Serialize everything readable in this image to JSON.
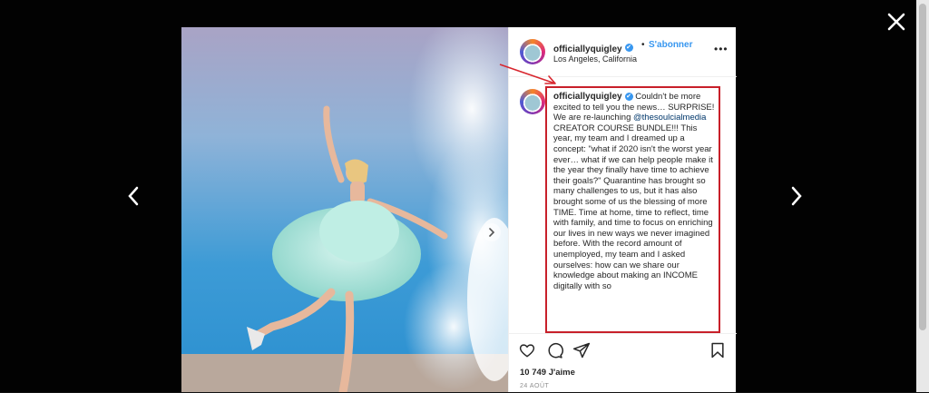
{
  "post": {
    "username": "officiallyquigley",
    "verified_badge": "✔",
    "separator": "•",
    "follow_label": "S'abonner",
    "location": "Los Angeles, California",
    "more_label": "•••",
    "caption_text": "Couldn't be more excited to tell you the news… SURPRISE! We are re-launching",
    "caption_mention": "@thesoulcialmedia",
    "caption_rest": "CREATOR COURSE BUNDLE!!! This year, my team and I dreamed up a concept: \"what if 2020 isn't the worst year ever… what if we can help people make it the year they finally have time to achieve their goals?\" Quarantine has brought so many challenges to us, but it has also brought some of us the blessing of more TIME. Time at home, time to reflect, time with family, and time to focus on enriching our lives in new ways we never imagined before. With the record amount of unemployed, my team and I asked ourselves: how can we share our knowledge about making an INCOME digitally with so",
    "likes": "10 749 J'aime",
    "date": "24 AOÛT"
  },
  "icons": {
    "close": "close-icon",
    "prev": "chevron-left-icon",
    "next": "chevron-right-icon",
    "like": "heart-icon",
    "comment": "comment-icon",
    "share": "send-icon",
    "save": "bookmark-icon"
  },
  "colors": {
    "accent_blue": "#3897f0",
    "highlight_red": "#c8202a",
    "text": "#262626"
  }
}
